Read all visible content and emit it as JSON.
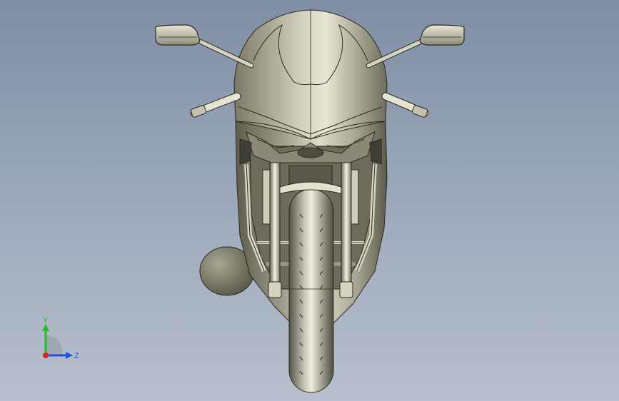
{
  "viewport": {
    "background_top": "#7f8ea4",
    "background_bottom": "#b8bfcd",
    "model": "motorcycle-front-view"
  },
  "triad": {
    "y_label": "Y",
    "z_label": "Z",
    "x_color": "#e02020",
    "y_color": "#22c022",
    "z_color": "#2050e0"
  }
}
